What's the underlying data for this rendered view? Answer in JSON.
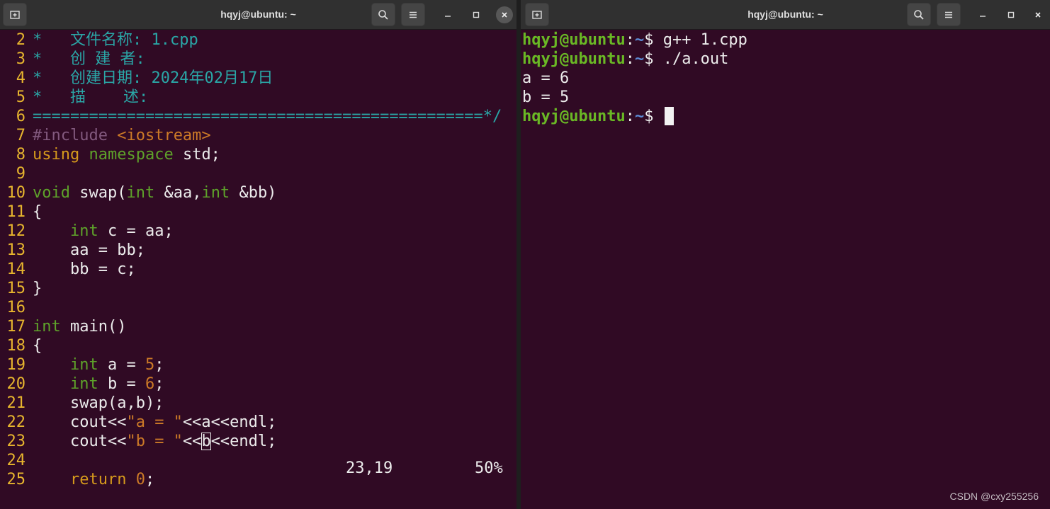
{
  "left_window": {
    "title": "hqyj@ubuntu: ~",
    "icons": {
      "new_tab": "new-tab-icon",
      "search": "search-icon",
      "menu": "hamburger-menu-icon",
      "minimize": "minimize-icon",
      "maximize": "maximize-icon",
      "close": "close-icon"
    },
    "code_lines": [
      {
        "no": "2",
        "segs": [
          {
            "t": "*   文件名称: 1.cpp",
            "c": "comment"
          }
        ]
      },
      {
        "no": "3",
        "segs": [
          {
            "t": "*   创 建 者:",
            "c": "comment"
          }
        ]
      },
      {
        "no": "4",
        "segs": [
          {
            "t": "*   创建日期: 2024年02月17日",
            "c": "comment"
          }
        ]
      },
      {
        "no": "5",
        "segs": [
          {
            "t": "*   描    述:",
            "c": "comment"
          }
        ]
      },
      {
        "no": "6",
        "segs": [
          {
            "t": "================================================*/",
            "c": "comment"
          }
        ]
      },
      {
        "no": "7",
        "segs": [
          {
            "t": "#include ",
            "c": "pre"
          },
          {
            "t": "<iostream>",
            "c": "str"
          }
        ]
      },
      {
        "no": "8",
        "segs": [
          {
            "t": "using ",
            "c": "kw"
          },
          {
            "t": "namespace",
            "c": "type"
          },
          {
            "t": " std;",
            "c": ""
          }
        ]
      },
      {
        "no": "9",
        "segs": []
      },
      {
        "no": "10",
        "segs": [
          {
            "t": "void",
            "c": "type"
          },
          {
            "t": " swap(",
            "c": ""
          },
          {
            "t": "int",
            "c": "type"
          },
          {
            "t": " &aa,",
            "c": ""
          },
          {
            "t": "int",
            "c": "type"
          },
          {
            "t": " &bb)",
            "c": ""
          }
        ]
      },
      {
        "no": "11",
        "segs": [
          {
            "t": "{",
            "c": ""
          }
        ]
      },
      {
        "no": "12",
        "segs": [
          {
            "t": "    ",
            "c": ""
          },
          {
            "t": "int",
            "c": "type"
          },
          {
            "t": " c = aa;",
            "c": ""
          }
        ]
      },
      {
        "no": "13",
        "segs": [
          {
            "t": "    aa = bb;",
            "c": ""
          }
        ]
      },
      {
        "no": "14",
        "segs": [
          {
            "t": "    bb = c;",
            "c": ""
          }
        ]
      },
      {
        "no": "15",
        "segs": [
          {
            "t": "}",
            "c": ""
          }
        ]
      },
      {
        "no": "16",
        "segs": []
      },
      {
        "no": "17",
        "segs": [
          {
            "t": "int",
            "c": "type"
          },
          {
            "t": " main()",
            "c": ""
          }
        ]
      },
      {
        "no": "18",
        "segs": [
          {
            "t": "{",
            "c": ""
          }
        ]
      },
      {
        "no": "19",
        "segs": [
          {
            "t": "    ",
            "c": ""
          },
          {
            "t": "int",
            "c": "type"
          },
          {
            "t": " a = ",
            "c": ""
          },
          {
            "t": "5",
            "c": "num"
          },
          {
            "t": ";",
            "c": ""
          }
        ]
      },
      {
        "no": "20",
        "segs": [
          {
            "t": "    ",
            "c": ""
          },
          {
            "t": "int",
            "c": "type"
          },
          {
            "t": " b = ",
            "c": ""
          },
          {
            "t": "6",
            "c": "num"
          },
          {
            "t": ";",
            "c": ""
          }
        ]
      },
      {
        "no": "21",
        "segs": [
          {
            "t": "    swap(a,b);",
            "c": ""
          }
        ]
      },
      {
        "no": "22",
        "segs": [
          {
            "t": "    cout<<",
            "c": ""
          },
          {
            "t": "\"a = \"",
            "c": "str"
          },
          {
            "t": "<<a<<endl;",
            "c": ""
          }
        ]
      },
      {
        "no": "23",
        "segs": [
          {
            "t": "    cout<<",
            "c": ""
          },
          {
            "t": "\"b = \"",
            "c": "str"
          },
          {
            "t": "<<",
            "c": ""
          },
          {
            "t": "b",
            "c": "cursor"
          },
          {
            "t": "<<endl;",
            "c": ""
          }
        ]
      },
      {
        "no": "24",
        "segs": []
      },
      {
        "no": "25",
        "segs": [
          {
            "t": "    ",
            "c": ""
          },
          {
            "t": "return",
            "c": "kw"
          },
          {
            "t": " ",
            "c": ""
          },
          {
            "t": "0",
            "c": "num"
          },
          {
            "t": ";",
            "c": ""
          }
        ]
      }
    ],
    "status_position": "23,19",
    "status_percent": "50%"
  },
  "right_window": {
    "title": "hqyj@ubuntu: ~",
    "prompt_user": "hqyj@ubuntu",
    "prompt_colon": ":",
    "prompt_path": "~",
    "prompt_symbol": "$ ",
    "lines": [
      {
        "type": "prompt",
        "cmd": "g++ 1.cpp"
      },
      {
        "type": "prompt",
        "cmd": "./a.out"
      },
      {
        "type": "output",
        "text": "a = 6"
      },
      {
        "type": "output",
        "text": "b = 5"
      },
      {
        "type": "prompt",
        "cmd": "",
        "cursor": true
      }
    ]
  },
  "watermark": "CSDN @cxy255256",
  "colors": {
    "terminal_bg": "#300a24",
    "titlebar_bg": "#303030",
    "prompt_user": "#6ab825",
    "prompt_path": "#5c8bd6",
    "line_number": "#e7b52e",
    "comment": "#2aa6a6",
    "type": "#5ea22a",
    "string": "#cc7a27"
  }
}
